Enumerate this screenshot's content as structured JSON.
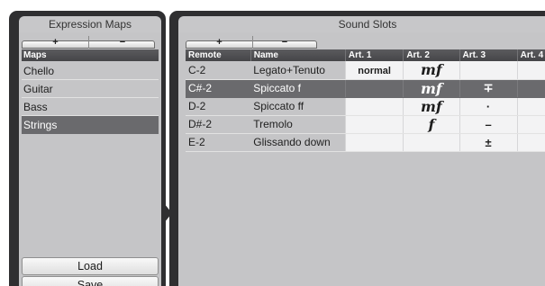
{
  "expression_maps": {
    "title": "Expression Maps",
    "add_label": "+",
    "remove_label": "−",
    "list_header": "Maps",
    "items": [
      "Chello",
      "Guitar",
      "Bass",
      "Strings"
    ],
    "selected_index": 3,
    "load_label": "Load",
    "save_label": "Save"
  },
  "sound_slots": {
    "title": "Sound Slots",
    "add_label": "+",
    "remove_label": "−",
    "headers": [
      "Remote",
      "Name",
      "Art. 1",
      "Art. 2",
      "Art. 3",
      "Art. 4"
    ],
    "rows": [
      {
        "remote": "C-2",
        "name": "Legato+Tenuto",
        "art1": "normal",
        "art2": "mf",
        "art3": "",
        "art4": ""
      },
      {
        "remote": "C#-2",
        "name": "Spiccato f",
        "art1": "",
        "art2": "mf",
        "art3": "∓",
        "art4": ""
      },
      {
        "remote": "D-2",
        "name": "Spiccato ff",
        "art1": "",
        "art2": "mf",
        "art3": "·",
        "art4": ""
      },
      {
        "remote": "D#-2",
        "name": "Tremolo",
        "art1": "",
        "art2": "f",
        "art3": "–",
        "art4": ""
      },
      {
        "remote": "E-2",
        "name": "Glissando down",
        "art1": "",
        "art2": "",
        "art3": "±",
        "art4": ""
      }
    ],
    "selected_row": 1
  },
  "colors": {
    "frame": "#2f2f31",
    "panel": "#c5c5c7",
    "selection": "#6a6a6d",
    "header": "#4f4f52"
  }
}
